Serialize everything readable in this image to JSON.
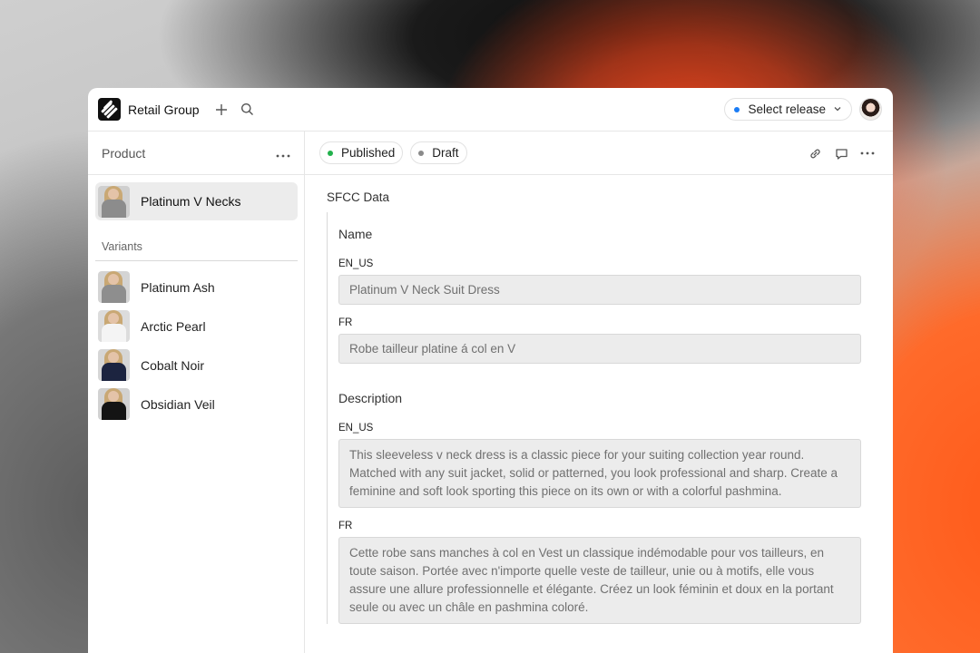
{
  "topbar": {
    "workspace_name": "Retail Group",
    "release_label": "Select release",
    "release_dot_color": "#1a7cf5"
  },
  "sidebar": {
    "title": "Product",
    "product": {
      "label": "Platinum V Necks"
    },
    "variants_label": "Variants",
    "variants": [
      {
        "label": "Platinum Ash"
      },
      {
        "label": "Arctic Pearl"
      },
      {
        "label": "Cobalt Noir"
      },
      {
        "label": "Obsidian Veil"
      }
    ]
  },
  "main": {
    "status_published": "Published",
    "status_published_color": "#22b14c",
    "status_draft": "Draft",
    "status_draft_color": "#8a8a8a",
    "section_title": "SFCC Data",
    "name_group": {
      "title": "Name",
      "en_label": "EN_US",
      "en_value": "Platinum V Neck Suit Dress",
      "fr_label": "FR",
      "fr_value": "Robe tailleur platine á col en V"
    },
    "description_group": {
      "title": "Description",
      "en_label": "EN_US",
      "en_value": "This sleeveless v neck dress is a classic piece for your suiting collection year round. Matched with any suit jacket, solid or patterned, you look professional and sharp. Create a feminine and soft look sporting this piece on its own or with a colorful pashmina.",
      "fr_label": "FR",
      "fr_value": "Cette robe sans manches à col en Vest un classique indémodable pour vos tailleurs, en toute saison. Portée avec n'importe quelle veste de tailleur, unie ou à motifs, elle vous assure une allure professionnelle et élégante. Créez un look féminin et doux en la portant seule ou avec un châle en pashmina coloré."
    }
  }
}
